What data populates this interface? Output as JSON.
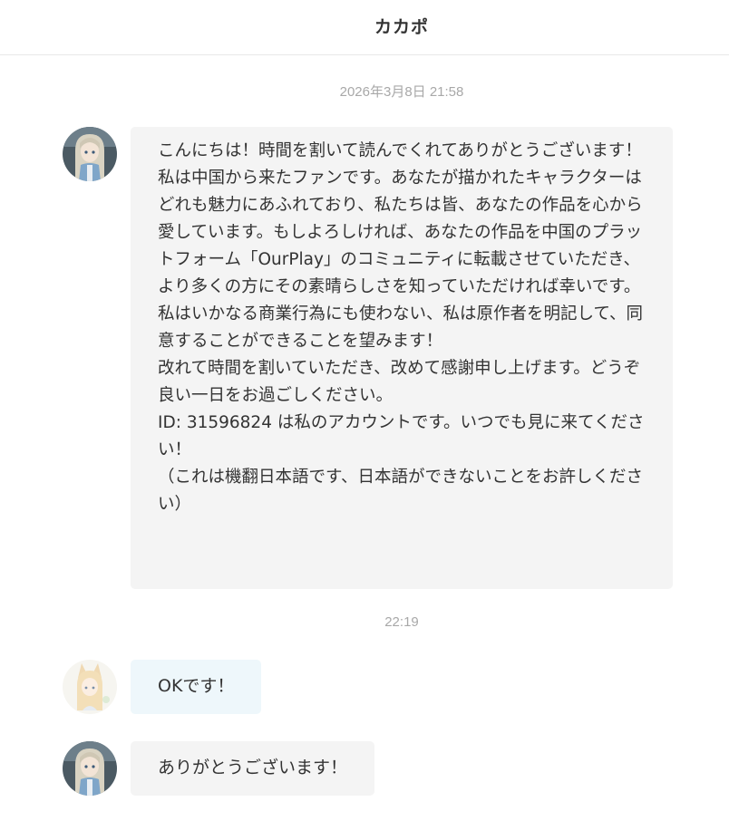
{
  "header": {
    "title": "カカポ"
  },
  "messages": [
    {
      "timestamp": "2026年3月8日 21:58",
      "sender": "contact",
      "avatar_icon": "anime-girl-avatar-icon",
      "text": "こんにちは！時間を割いて読んでくれてありがとうございます！\n私は中国から来たファンです。あなたが描かれたキャラクターはどれも魅力にあふれており、私たちは皆、あなたの作品を心から愛しています。もしよろしければ、あなたの作品を中国のプラットフォーム「OurPlay」のコミュニティに転載させていただき、より多くの方にその素晴らしさを知っていただければ幸いです。私はいかなる商業行為にも使わない、私は原作者を明記して、同意することができることを望みます！\n改れて時間を割いていただき、改めて感謝申し上げます。どうぞ良い一日をお過ごしください。\nID: 31596824 は私のアカウントです。いつでも見に来てください！\n（これは機翻日本語です、日本語ができないことをお許しください）"
    },
    {
      "timestamp": "22:19",
      "sender": "self",
      "avatar_icon": "fox-girl-avatar-icon",
      "text": "OKです！"
    },
    {
      "sender": "contact",
      "avatar_icon": "anime-girl-avatar-icon",
      "text": "ありがとうございます！"
    }
  ],
  "colors": {
    "incoming_bubble": "#f4f4f4",
    "self_bubble": "#eef7fb",
    "timestamp_text": "#a8a8a8",
    "header_border": "#e8e8e8"
  }
}
